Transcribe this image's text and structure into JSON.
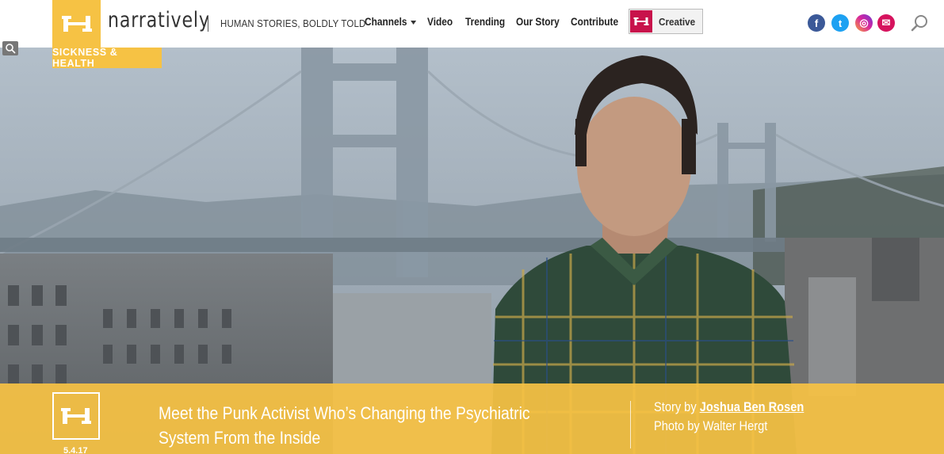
{
  "header": {
    "brand": "narratively",
    "tagline": "HUMAN STORIES, BOLDLY TOLD",
    "nav": {
      "channels": "Channels",
      "video": "Video",
      "trending": "Trending",
      "our_story": "Our Story",
      "contribute": "Contribute"
    },
    "creative_label": "Creative",
    "social": {
      "facebook_glyph": "f",
      "twitter_glyph": "t",
      "instagram_glyph": "◎",
      "email_glyph": "✉"
    }
  },
  "section": {
    "label": "SICKNESS & HEALTH"
  },
  "article": {
    "title": "Meet the Punk Activist Who’s Changing the Psychiatric System From the Inside",
    "date": "5.4.17",
    "story_prefix": "Story by ",
    "author": "Joshua Ben Rosen",
    "photo_credit": "Photo by Walter Hergt"
  },
  "colors": {
    "accent": "#f6c244",
    "creative": "#c8124b",
    "facebook": "#3b5998",
    "twitter": "#1da1f2",
    "email": "#d6135e"
  }
}
